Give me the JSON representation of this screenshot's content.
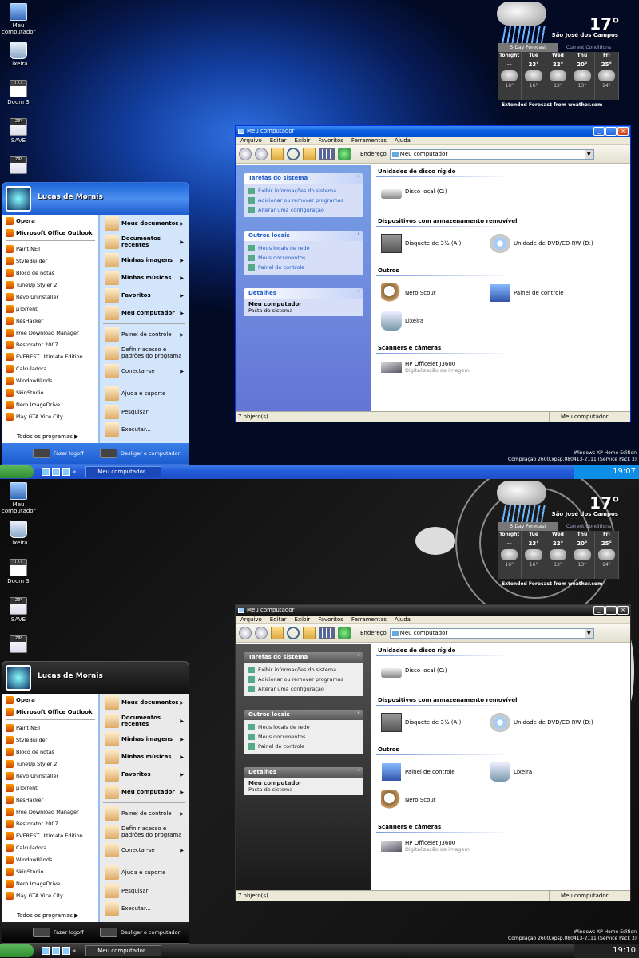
{
  "desktop_icons": [
    {
      "label": "Meu computador",
      "kind": "pc"
    },
    {
      "label": "Lixeira",
      "kind": "bin"
    },
    {
      "label": "Doom 3",
      "kind": "txt"
    },
    {
      "label": "SAVE",
      "kind": "zip"
    },
    {
      "label": "",
      "kind": "zip"
    }
  ],
  "weather": {
    "temp": "17°",
    "unit": "c",
    "city": "São José dos Campos",
    "tab_forecast": "5-Day Forecast",
    "tab_current": "Current Conditions",
    "days": [
      {
        "day": "Tonight",
        "hi": "--",
        "lo": "16°"
      },
      {
        "day": "Tue",
        "hi": "23°",
        "lo": "16°"
      },
      {
        "day": "Wed",
        "hi": "22°",
        "lo": "13°"
      },
      {
        "day": "Thu",
        "hi": "20°",
        "lo": "13°"
      },
      {
        "day": "Fri",
        "hi": "25°",
        "lo": "14°"
      }
    ],
    "footer": "Extended Forecast from weather.com"
  },
  "os_info": {
    "edition": "Windows XP Home Edition",
    "build": "Compilação 2600.xpsp.080413-2111 (Service Pack 3)"
  },
  "explorer": {
    "title": "Meu computador",
    "menu": [
      "Arquivo",
      "Editar",
      "Exibir",
      "Favoritos",
      "Ferramentas",
      "Ajuda"
    ],
    "address_label": "Endereço",
    "address_value": "Meu computador",
    "panels": {
      "tasks": {
        "title": "Tarefas do sistema",
        "items": [
          "Exibir informações do sistema",
          "Adicionar ou remover programas",
          "Alterar uma configuração"
        ]
      },
      "places": {
        "title": "Outros locais",
        "items": [
          "Meus locais de rede",
          "Meus documentos",
          "Painel de controle"
        ]
      },
      "details": {
        "title": "Detalhes",
        "name": "Meu computador",
        "desc": "Pasta do sistema"
      }
    },
    "sections": {
      "hdd": "Unidades de disco rígido",
      "removable": "Dispositivos com armazenamento removível",
      "other": "Outros",
      "scanners": "Scanners e câmeras"
    },
    "items": {
      "local_disk": "Disco local (C:)",
      "floppy": "Disquete de 3½ (A:)",
      "dvd": "Unidade de DVD/CD-RW (D:)",
      "nero": "Nero Scout",
      "control_panel": "Painel de controle",
      "recycle": "Lixeira",
      "printer": "HP Officejet J3600",
      "printer_sub": "Digitalização de imagem"
    },
    "status_left": "7 objeto(s)",
    "status_right": "Meu computador"
  },
  "start_menu": {
    "user": "Lucas de Morais",
    "pinned": [
      "Opera",
      "Microsoft Office Outlook"
    ],
    "recent": [
      "Paint.NET",
      "StyleBuilder",
      "Bloco de notas",
      "TuneUp Styler 2",
      "Revo Uninstaller",
      "µTorrent",
      "ResHacker",
      "Free Download Manager",
      "Restorator 2007",
      "EVEREST Ultimate Edition",
      "Calculadora",
      "WindowBlinds",
      "SkinStudio",
      "Nero ImageDrive",
      "Play GTA Vice City"
    ],
    "all_programs": "Todos os programas",
    "right": {
      "my_docs": "Meus documentos",
      "recent_docs": "Documentos recentes",
      "my_pics": "Minhas imagens",
      "my_music": "Minhas músicas",
      "favorites": "Favoritos",
      "my_computer": "Meu computador",
      "control_panel": "Painel de controle",
      "defaults": "Definir acesso e padrões do programa",
      "connect": "Conectar-se",
      "help": "Ajuda e suporte",
      "search": "Pesquisar",
      "run": "Executar..."
    },
    "logoff": "Fazer logoff",
    "shutdown": "Desligar o computador"
  },
  "taskbar": {
    "task_label": "Meu computador",
    "time_top": "19:07",
    "time_bottom": "19:10"
  }
}
